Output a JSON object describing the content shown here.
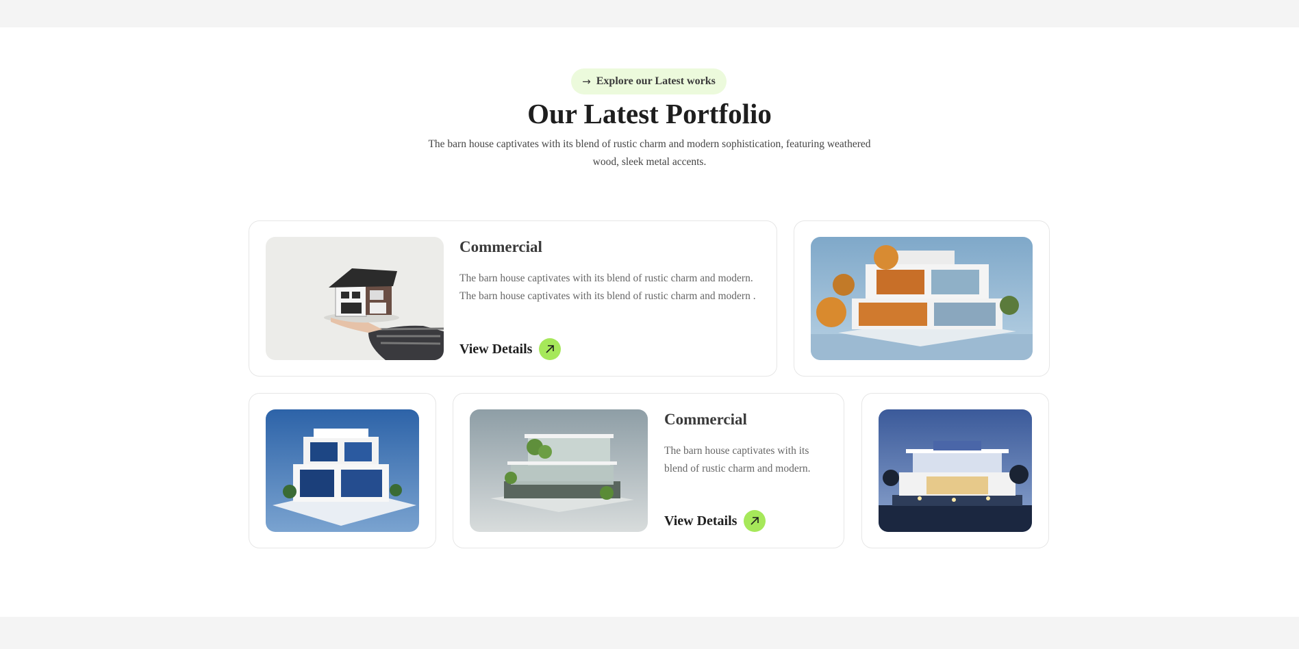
{
  "header": {
    "badge_label": "Explore our Latest works",
    "title": "Our Latest Portfolio",
    "subtitle": "The barn house captivates with its blend of rustic charm and modern sophistication, featuring weathered wood, sleek metal accents."
  },
  "cards": [
    {
      "title": "Commercial",
      "text": "The barn house captivates with its blend of rustic charm and modern. The barn house captivates with its blend of rustic charm and modern .",
      "link_label": "View Details",
      "image": "house-model-on-hand"
    },
    {
      "image": "modern-house-with-orange-trees"
    },
    {
      "image": "white-blue-modern-house"
    },
    {
      "title": "Commercial",
      "text": "The barn house captivates with its blend of rustic charm and modern.",
      "link_label": "View Details",
      "image": "glass-house-with-greenery"
    },
    {
      "image": "house-at-night"
    }
  ],
  "colors": {
    "accent": "#a6e85a",
    "badge_bg": "#ecfadc",
    "page_bg": "#f4f4f4"
  },
  "icons": {
    "badge": "arrow-right-icon",
    "link": "arrow-up-right-icon"
  }
}
